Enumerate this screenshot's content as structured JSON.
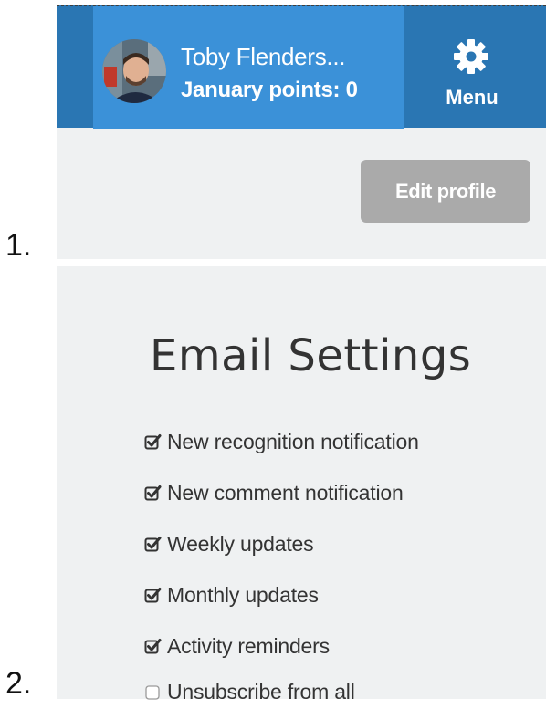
{
  "steps": [
    "1.",
    "2."
  ],
  "header": {
    "user_name": "Toby Flenders...",
    "points_label": "January points: 0",
    "menu_label": "Menu",
    "menu_icon": "gear-icon",
    "avatar_icon": "avatar-photo"
  },
  "profile": {
    "edit_button_label": "Edit profile"
  },
  "email_settings": {
    "title": "Email Settings",
    "options": [
      {
        "label": "New recognition notification",
        "checked": true
      },
      {
        "label": "New comment notification",
        "checked": true
      },
      {
        "label": "Weekly updates",
        "checked": true
      },
      {
        "label": "Monthly updates",
        "checked": true
      },
      {
        "label": "Activity reminders",
        "checked": true
      },
      {
        "label": "Unsubscribe from all",
        "checked": false
      }
    ]
  },
  "colors": {
    "header_bg": "#2a76b3",
    "user_block_bg": "#3b91d8",
    "panel_bg": "#eff1f2",
    "button_bg": "#aaaaaa"
  }
}
